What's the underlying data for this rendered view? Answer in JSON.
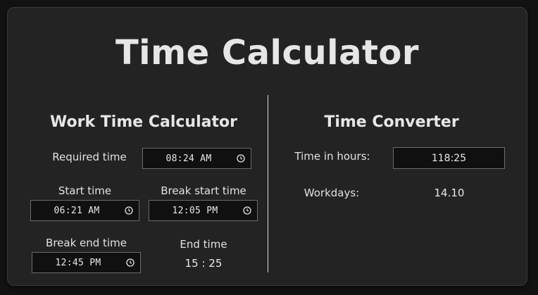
{
  "title": "Time Calculator",
  "work": {
    "heading": "Work Time Calculator",
    "required_label": "Required time",
    "required_value": "08:24 AM",
    "start_label": "Start time",
    "start_value": "06:21 AM",
    "break_start_label": "Break start time",
    "break_start_value": "12:05 PM",
    "break_end_label": "Break end time",
    "break_end_value": "12:45 PM",
    "end_label": "End time",
    "end_value": "15 : 25"
  },
  "converter": {
    "heading": "Time Converter",
    "hours_label": "Time in hours:",
    "hours_value": "118:25",
    "workdays_label": "Workdays:",
    "workdays_value": "14.10"
  },
  "icons": {
    "time_picker": "clock-icon"
  },
  "colors": {
    "background": "#121212",
    "card": "#232323",
    "input_bg": "#101010",
    "text": "#e6e6e6",
    "divider": "#d8d8d8"
  }
}
